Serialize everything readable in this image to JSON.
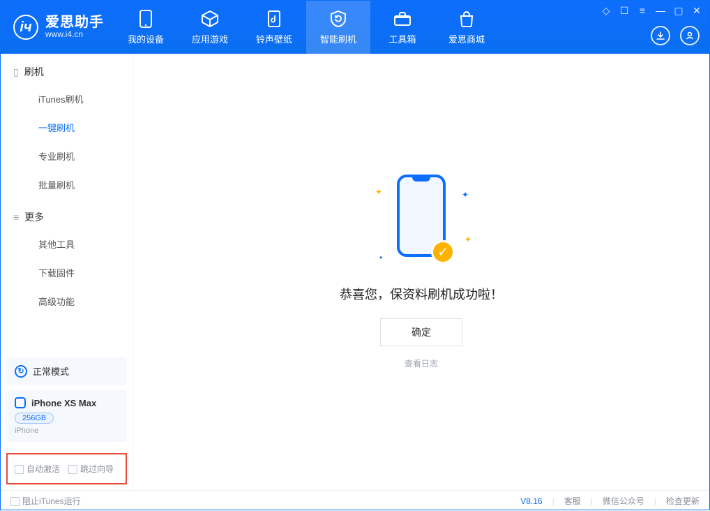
{
  "app": {
    "name_cn": "爱思助手",
    "name_en": "www.i4.cn"
  },
  "nav": {
    "my_device": "我的设备",
    "apps_games": "应用游戏",
    "ringtones": "铃声壁纸",
    "smart_flash": "智能刷机",
    "toolbox": "工具箱",
    "store": "爱思商城"
  },
  "sidebar": {
    "sec_flash": "刷机",
    "items_flash": {
      "itunes": "iTunes刷机",
      "oneclick": "一键刷机",
      "pro": "专业刷机",
      "batch": "批量刷机"
    },
    "sec_more": "更多",
    "items_more": {
      "other_tools": "其他工具",
      "download_fw": "下载固件",
      "advanced": "高级功能"
    },
    "mode": "正常模式",
    "device_name": "iPhone XS Max",
    "storage": "256GB",
    "device_type": "iPhone",
    "opt_auto_activate": "自动激活",
    "opt_skip_wizard": "跳过向导"
  },
  "main": {
    "success": "恭喜您，保资料刷机成功啦！",
    "ok": "确定",
    "view_log": "查看日志"
  },
  "footer": {
    "block_itunes": "阻止iTunes运行",
    "version": "V8.16",
    "support": "客服",
    "wechat": "微信公众号",
    "check_update": "检查更新"
  }
}
